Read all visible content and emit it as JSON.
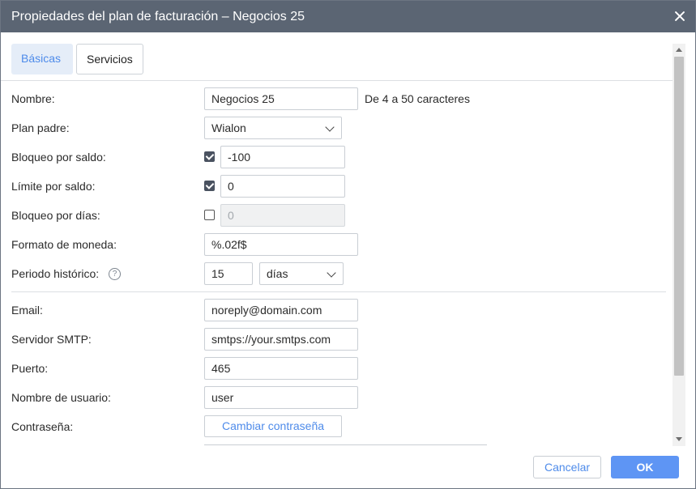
{
  "dialog": {
    "title": "Propiedades del plan de facturación – Negocios 25",
    "close_icon": "close-icon"
  },
  "tabs": [
    {
      "label": "Básicas",
      "active": true
    },
    {
      "label": "Servicios",
      "active": false
    }
  ],
  "form": {
    "name": {
      "label": "Nombre:",
      "value": "Negocios 25",
      "hint": "De 4 a 50 caracteres"
    },
    "parent_plan": {
      "label": "Plan padre:",
      "value": "Wialon"
    },
    "balance_block": {
      "label": "Bloqueo por saldo:",
      "checked": true,
      "value": "-100"
    },
    "balance_limit": {
      "label": "Límite por saldo:",
      "checked": true,
      "value": "0"
    },
    "days_block": {
      "label": "Bloqueo por días:",
      "checked": false,
      "value": "0"
    },
    "currency_format": {
      "label": "Formato de moneda:",
      "value": "%.02f$"
    },
    "history_period": {
      "label": "Periodo histórico:",
      "help": "?",
      "value": "15",
      "unit": "días"
    },
    "email": {
      "label": "Email:",
      "value": "noreply@domain.com"
    },
    "smtp_server": {
      "label": "Servidor SMTP:",
      "value": "smtps://your.smtps.com"
    },
    "port": {
      "label": "Puerto:",
      "value": "465"
    },
    "username": {
      "label": "Nombre de usuario:",
      "value": "user"
    },
    "password": {
      "label": "Contraseña:",
      "button": "Cambiar contraseña"
    }
  },
  "footer": {
    "cancel": "Cancelar",
    "ok": "OK"
  },
  "colors": {
    "titlebar": "#5b6573",
    "accent": "#4e8bea",
    "ok_button": "#5e95f4",
    "active_tab_bg": "#e5edf8"
  }
}
